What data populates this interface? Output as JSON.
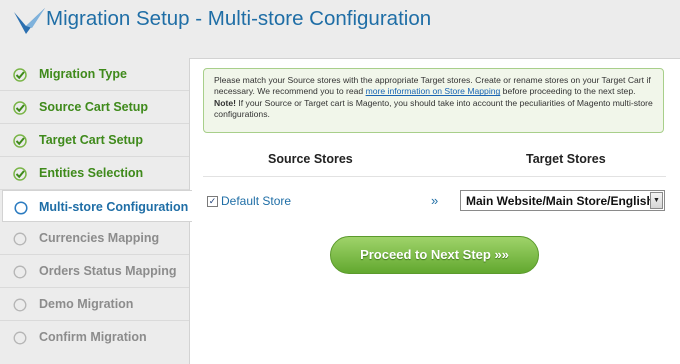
{
  "header": {
    "title": "Migration Setup - Multi-store Configuration"
  },
  "sidebar": {
    "steps": [
      {
        "label": "Migration Type",
        "status": "done"
      },
      {
        "label": "Source Cart Setup",
        "status": "done"
      },
      {
        "label": "Target Cart Setup",
        "status": "done"
      },
      {
        "label": "Entities Selection",
        "status": "done"
      },
      {
        "label": "Multi-store Configuration",
        "status": "active"
      },
      {
        "label": "Currencies Mapping",
        "status": "pending"
      },
      {
        "label": "Orders Status Mapping",
        "status": "pending"
      },
      {
        "label": "Demo Migration",
        "status": "pending"
      },
      {
        "label": "Confirm Migration",
        "status": "pending"
      }
    ]
  },
  "notice": {
    "text_before_link": "Please match your Source stores with the appropriate Target stores. Create or rename stores on your Target Cart if necessary. We recommend you to read ",
    "link": "more information on Store Mapping",
    "text_after_link": " before proceeding to the next step.",
    "note_label": "Note!",
    "note_text": " If your Source or Target cart is Magento, you should take into account the peculiarities of Magento multi-store configurations."
  },
  "mapping": {
    "source_header": "Source Stores",
    "target_header": "Target Stores",
    "rows": [
      {
        "checked": true,
        "source": "Default Store",
        "arrow": "»",
        "target": "Main Website/Main Store/English"
      }
    ]
  },
  "actions": {
    "proceed_label": "Proceed to Next Step »»"
  },
  "colors": {
    "accent": "#1f6ea6",
    "done": "#3f8a1b",
    "pending": "#8c8c8c",
    "button": "#7bbd45"
  }
}
